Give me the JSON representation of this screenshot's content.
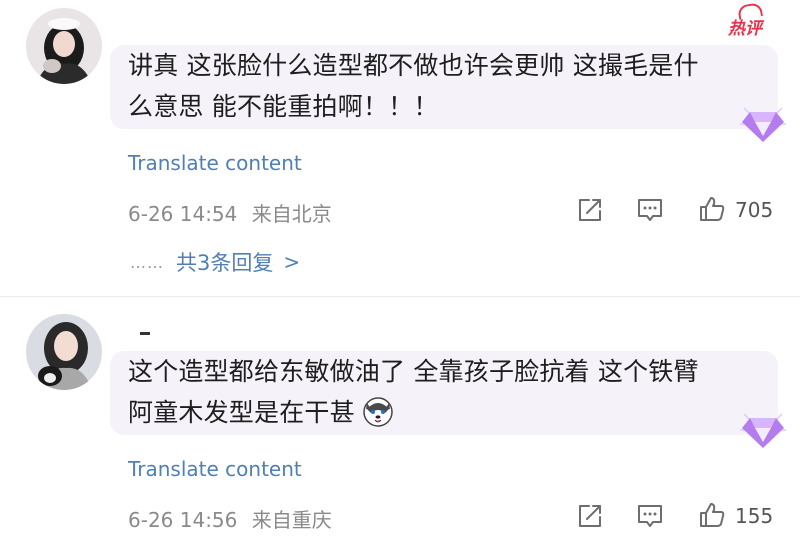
{
  "comments": [
    {
      "text": "讲真 这张脸什么造型都不做也许会更帅 这撮毛是什么意思 能不能重拍啊！！！",
      "hot_badge": "热评",
      "translate": "Translate content",
      "date": "6-26 14:54",
      "location": "来自北京",
      "likes": "705",
      "replies_label": "共3条回复",
      "replies_dots": "……",
      "replies_arrow": ">"
    },
    {
      "text": "这个造型都给东敏做油了 全靠孩子脸抗着 这个铁臂阿童木发型是在干甚",
      "translate": "Translate content",
      "date": "6-26 14:56",
      "location": "来自重庆",
      "likes": "155"
    }
  ],
  "icons": {
    "share": "share-icon",
    "comment": "comment-icon",
    "like": "thumbs-up-icon",
    "gem": "diamond-badge-icon",
    "emoji": "husky-emoji-icon"
  },
  "colors": {
    "link": "#4f7fb3",
    "bubble": "#f6f2fa",
    "hot": "#e8334a",
    "meta": "#8a8a8a",
    "gem": "#b57cf0"
  }
}
